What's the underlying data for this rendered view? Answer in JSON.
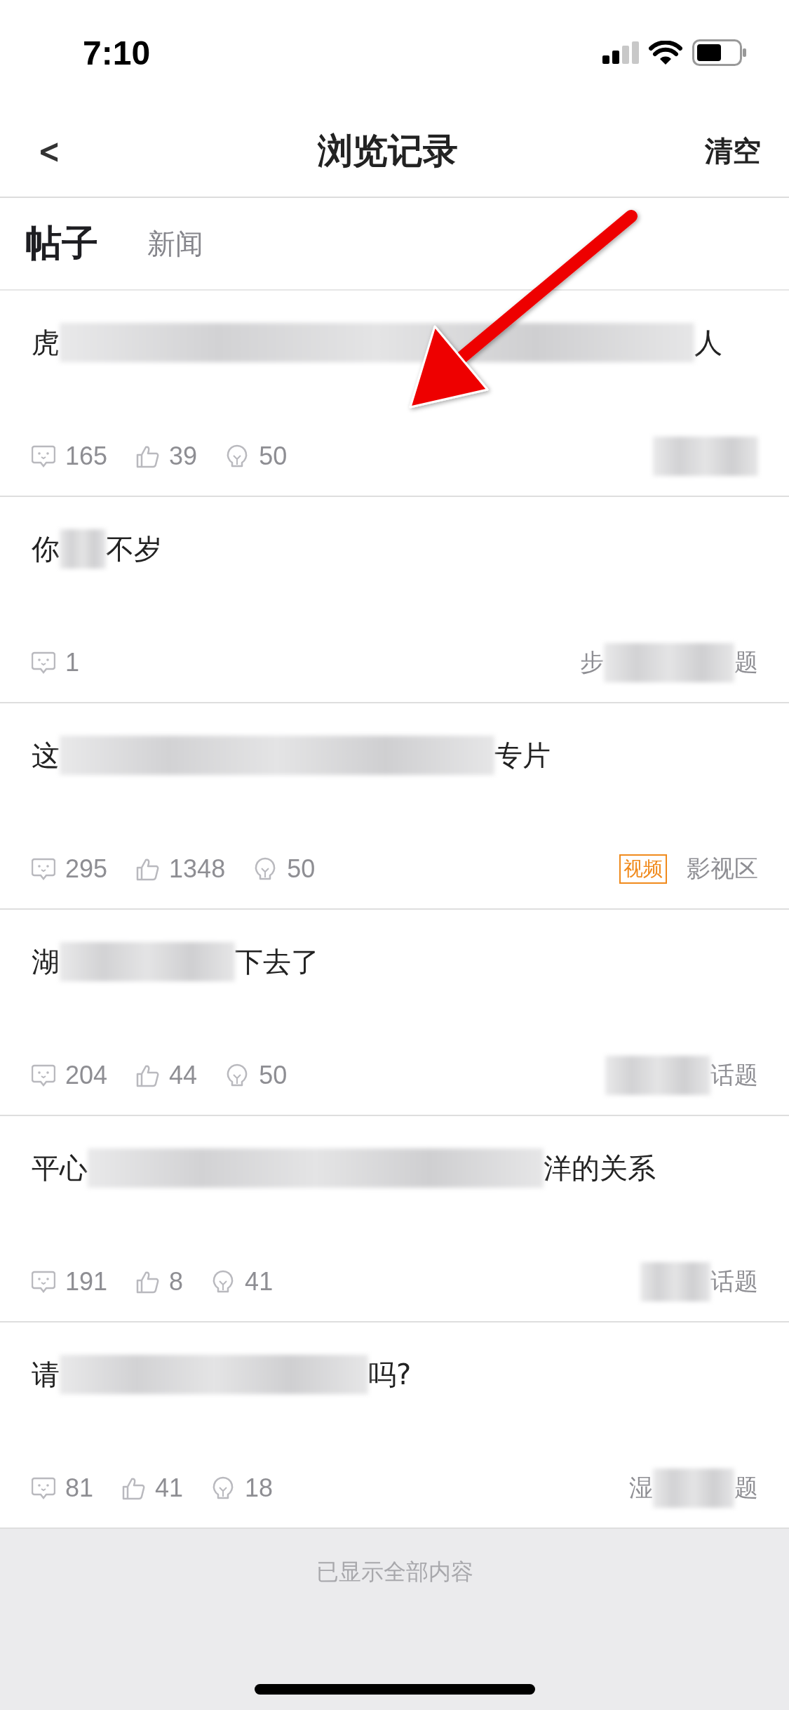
{
  "status_bar": {
    "time": "7:10"
  },
  "nav": {
    "back": "<",
    "title": "浏览记录",
    "action": "清空"
  },
  "tabs": [
    {
      "label": "帖子",
      "selected": true
    },
    {
      "label": "新闻",
      "selected": false
    }
  ],
  "posts": [
    {
      "title_start": "虎",
      "title_end": "人",
      "stats": [
        {
          "kind": "comment",
          "count": "165"
        },
        {
          "kind": "like",
          "count": "39"
        },
        {
          "kind": "idea",
          "count": "50"
        }
      ]
    },
    {
      "title_start": "你",
      "title_end": "不岁",
      "stats": [
        {
          "kind": "comment",
          "count": "1"
        }
      ],
      "topic_start": "步",
      "topic_end": "题"
    },
    {
      "title_start": "这",
      "title_end": "专片",
      "stats": [
        {
          "kind": "comment",
          "count": "295"
        },
        {
          "kind": "like",
          "count": "1348"
        },
        {
          "kind": "idea",
          "count": "50"
        }
      ],
      "tag": "视频",
      "topic_start": "影视区"
    },
    {
      "title_start": "湖",
      "title_end": "下去了",
      "stats": [
        {
          "kind": "comment",
          "count": "204"
        },
        {
          "kind": "like",
          "count": "44"
        },
        {
          "kind": "idea",
          "count": "50"
        }
      ],
      "topic_end": "话题"
    },
    {
      "title_start": "平心",
      "title_end": "洋的关系",
      "stats": [
        {
          "kind": "comment",
          "count": "191"
        },
        {
          "kind": "like",
          "count": "8"
        },
        {
          "kind": "idea",
          "count": "41"
        }
      ],
      "topic_end": "话题"
    },
    {
      "title_start": "请",
      "title_end": "吗?",
      "stats": [
        {
          "kind": "comment",
          "count": "81"
        },
        {
          "kind": "like",
          "count": "41"
        },
        {
          "kind": "idea",
          "count": "18"
        }
      ],
      "topic_start": "湿",
      "topic_end": "题"
    }
  ],
  "footer": "已显示全部内容"
}
